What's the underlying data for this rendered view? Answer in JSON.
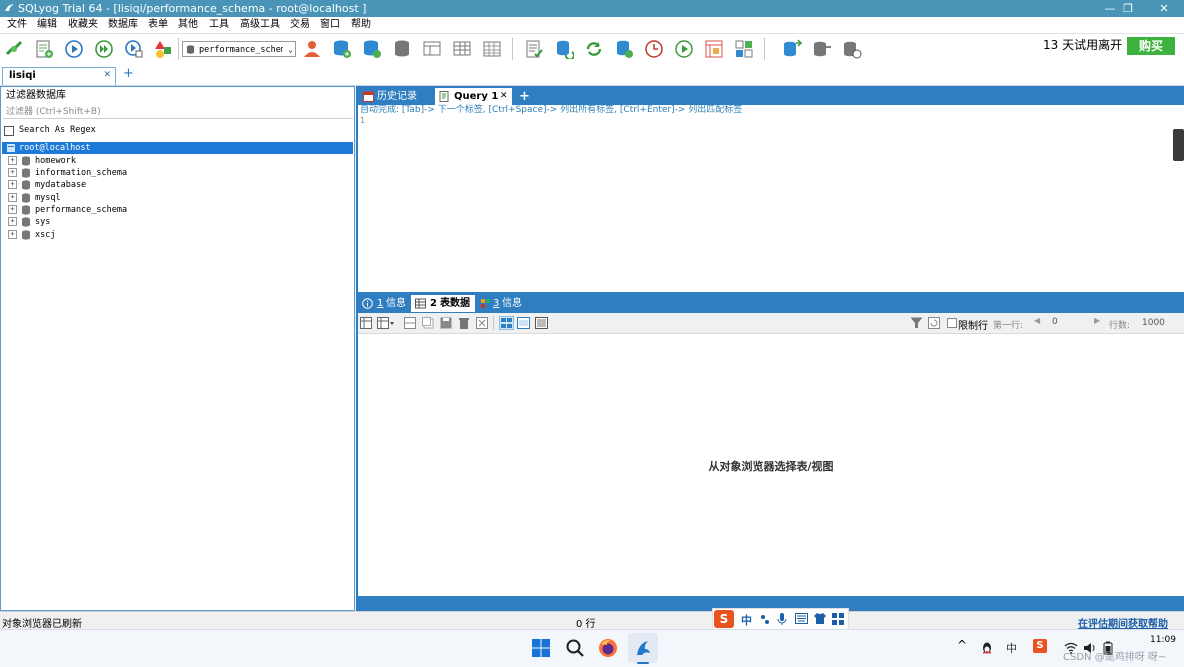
{
  "window": {
    "title": "SQLyog Trial 64 - [lisiqi/performance_schema - root@localhost ]",
    "minimize_glyph": "—",
    "restore_glyph": "❐",
    "close_glyph": "✕"
  },
  "menu": [
    "文件",
    "编辑",
    "收藏夹",
    "数据库",
    "表单",
    "其他",
    "工具",
    "高级工具",
    "交易",
    "窗口",
    "帮助"
  ],
  "toolbar": {
    "db_selector_value": "performance_schema",
    "trial_text": "13 天试用离开",
    "buy_label": "购买"
  },
  "connection_tab": {
    "label": "lisiqi",
    "close_glyph": "✕",
    "add_glyph": "+"
  },
  "object_browser": {
    "heading": "过滤器数据库",
    "filter_placeholder": "过滤器 (Ctrl+Shift+B)",
    "regex_label": "Search As Regex",
    "root": "root@localhost",
    "databases": [
      "homework",
      "information_schema",
      "mydatabase",
      "mysql",
      "performance_schema",
      "sys",
      "xscj"
    ]
  },
  "query_tabs": {
    "history_label": "历史记录",
    "query_label": "Query 1",
    "close_glyph": "✕",
    "add_glyph": "+"
  },
  "editor": {
    "autocomplete_hint": "自动完成: [Tab]-> 下一个标签, [Ctrl+Space]-> 列出所有标签, [Ctrl+Enter]-> 列出匹配标签",
    "line_number": "1"
  },
  "result_tabs": [
    {
      "num": "1",
      "label": "信息"
    },
    {
      "num": "2",
      "label": "表数据"
    },
    {
      "num": "3",
      "label": "信息"
    }
  ],
  "result_toolbar": {
    "limit_label": "限制行",
    "first_row_label": "第一行:",
    "first_row_value": "0",
    "rows_label": "行数:",
    "rows_value": "1000"
  },
  "result_empty_message": "从对象浏览器选择表/视图",
  "status": {
    "left": "对象浏览器已刷新",
    "rows": "0 行",
    "right_link": "在评估期间获取帮助"
  },
  "ime": {
    "logo": "S",
    "lang": "中"
  },
  "taskbar": {
    "clock": "11:09",
    "tray_lang": "中",
    "watermark": "CSDN @是鸡排呀 呀~"
  },
  "colors": {
    "titlebar": "#4a95b7",
    "panel_blue": "#2f7ec1",
    "root_highlight": "#1e7ad9",
    "buy_green": "#3db23e",
    "hint_blue": "#2e7fb8"
  }
}
